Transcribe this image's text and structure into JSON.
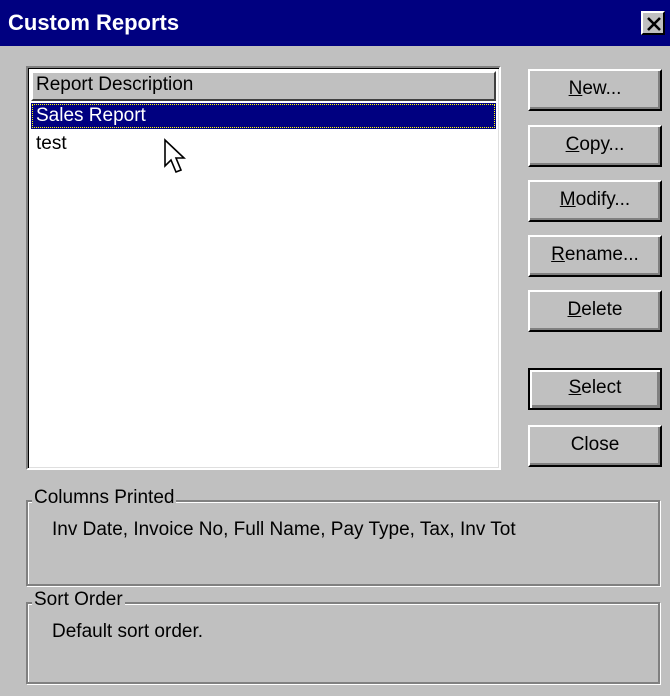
{
  "window": {
    "title": "Custom Reports",
    "close_glyph": "×"
  },
  "report_list": {
    "column_header": "Report Description",
    "items": [
      {
        "label": "Sales Report",
        "selected": true
      },
      {
        "label": "test",
        "selected": false
      }
    ]
  },
  "buttons": {
    "new": {
      "mnemonic": "N",
      "rest": "ew..."
    },
    "copy": {
      "mnemonic": "C",
      "rest": "opy..."
    },
    "modify": {
      "mnemonic": "M",
      "rest": "odify..."
    },
    "rename": {
      "mnemonic": "R",
      "rest": "ename..."
    },
    "delete": {
      "mnemonic": "D",
      "rest": "elete"
    },
    "select": {
      "mnemonic": "S",
      "rest": "elect"
    },
    "close": {
      "label": "Close"
    }
  },
  "columns_printed": {
    "legend": "Columns Printed",
    "value": "Inv Date,  Invoice No, Full Name, Pay Type, Tax, Inv Tot"
  },
  "sort_order": {
    "legend": "Sort Order",
    "value": "Default sort order."
  },
  "colors": {
    "titlebar": "#000080",
    "face": "#c0c0c0",
    "selection": "#000080"
  }
}
